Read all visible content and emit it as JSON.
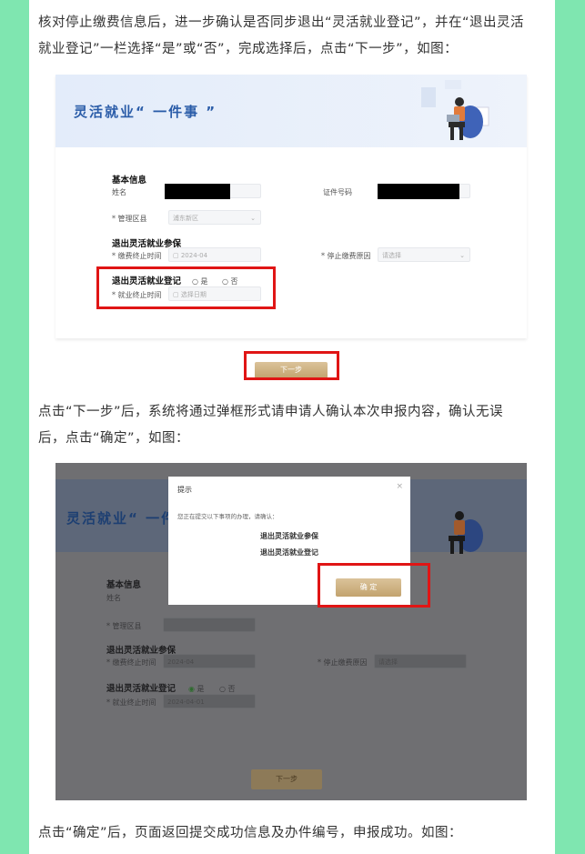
{
  "para1": [
    "核对停止缴费信息后，进一步确认是否同步退出“灵活就业登记”，并在“退出灵活",
    "就业登记”一栏选择“是”或“否”，完成选择后，点击“下一步”，如图："
  ],
  "para2": [
    "点击“下一步”后，系统将通过弹框形式请申请人确认本次申报内容，确认无误",
    "后，点击“确定”，如图："
  ],
  "para3": "点击“确定”后，页面返回提交成功信息及办件编号，申报成功。如图：",
  "shot1": {
    "banner_title": "灵活就业“ 一件事 ”",
    "basic_info": "基本信息",
    "name_label": "姓名",
    "id_label": "证件号码",
    "region_label": "* 管理区县",
    "region_value": "浦东新区",
    "exit_insurance": "退出灵活就业参保",
    "stop_time_label": "* 缴费终止时间",
    "stop_time_value": "2024-04",
    "stop_reason_label": "* 停止缴费原因",
    "stop_reason_value": "请选择",
    "exit_register": "退出灵活就业登记",
    "yes": "是",
    "no": "否",
    "end_time_label": "* 就业终止时间",
    "end_time_placeholder": "选择日期",
    "next_button": "下一步"
  },
  "shot2": {
    "banner_title": "灵活就业“ 一件事 ”",
    "basic_info": "基本信息",
    "name_label": "姓名",
    "region_label": "* 管理区县",
    "exit_insurance": "退出灵活就业参保",
    "stop_time_label": "* 缴费终止时间",
    "stop_time_value": "2024-04",
    "stop_reason_label": "* 停止缴费原因",
    "stop_reason_value": "请选择",
    "exit_register": "退出灵活就业登记",
    "yes": "是",
    "no": "否",
    "end_time_label": "* 就业终止时间",
    "end_time_value": "2024-04-01",
    "next_button": "下一步",
    "modal": {
      "title": "提示",
      "close": "×",
      "text": "您正在提交以下事项的办理，请确认：",
      "item1": "退出灵活就业参保",
      "item2": "退出灵活就业登记",
      "confirm": "确 定"
    }
  },
  "colors": {
    "highlight": "#e01515",
    "gold": "#c8a873",
    "banner_text": "#2a5ca8",
    "page_bg": "#7fe6b0"
  }
}
